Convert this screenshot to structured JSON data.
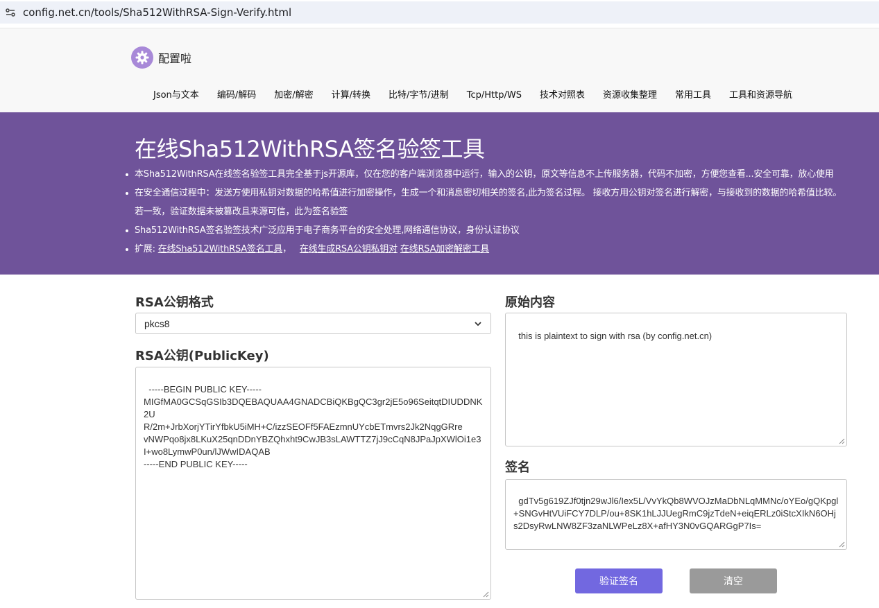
{
  "browser": {
    "url": "config.net.cn/tools/Sha512WithRSA-Sign-Verify.html"
  },
  "header": {
    "logo_text": "配置啦",
    "nav": [
      "Json与文本",
      "编码/解码",
      "加密/解密",
      "计算/转换",
      "比特/字节/进制",
      "Tcp/Http/WS",
      "技术对照表",
      "资源收集整理",
      "常用工具",
      "工具和资源导航"
    ]
  },
  "hero": {
    "title": "在线Sha512WithRSA签名验签工具",
    "bullets": [
      "本Sha512WithRSA在线签名验签工具完全基于js开源库，仅在您的客户端浏览器中运行，输入的公钥，原文等信息不上传服务器，代码不加密，方便您查看...安全可靠，放心使用",
      "在安全通信过程中：发送方使用私钥对数据的哈希值进行加密操作，生成一个和消息密切相关的签名,此为签名过程。 接收方用公钥对签名进行解密，与接收到的数据的哈希值比较。若一致，验证数据未被篡改且来源可信，此为签名验签",
      "Sha512WithRSA签名验签技术广泛应用于电子商务平台的安全处理,网络通信协议，身份认证协议"
    ],
    "ext_prefix": "扩展:",
    "ext_links": [
      "在线Sha512WithRSA签名工具",
      "在线生成RSA公钥私钥对",
      "在线RSA加密解密工具"
    ],
    "ext_sep": "，"
  },
  "form": {
    "format_label": "RSA公钥格式",
    "format_value": "pkcs8",
    "pubkey_label": "RSA公钥(PublicKey)",
    "pubkey_value": "-----BEGIN PUBLIC KEY-----\nMIGfMA0GCSqGSIb3DQEBAQUAA4GNADCBiQKBgQC3gr2jE5o96SeitqtDIUDDNK2U\nR/2m+JrbXorjYTirYfbkU5iMH+C/izzSEOFf5FAEzmnUYcbETmvrs2Jk2NqgGRre\nvNWPqo8jx8LKuX25qnDDnYBZQhxht9CwJB3sLAWTTZ7jJ9cCqN8JPaJpXWlOi1e3\nI+wo8LymwP0un/lJWwIDAQAB\n-----END PUBLIC KEY-----",
    "plaintext_label": "原始内容",
    "plaintext_value": "this is plaintext to sign with rsa (by config.net.cn)",
    "signature_label": "签名",
    "signature_value": "gdTv5g619ZJf0tjn29wJl6/Iex5L/VvYkQb8WVOJzMaDbNLqMMNc/oYEo/gQKpgl+SNGvHtVUiFCY7DLP/ou+8SK1hLJJUegRmC9jzTdeN+eiqERLz0iStcXIkN6OHjs2DsyRwLNW8ZF3zaNLWPeLz8X+afHY3N0vGQARGgP7Is=",
    "verify_button": "验证签名",
    "clear_button": "清空"
  },
  "colors": {
    "hero_bg": "#6f539a",
    "verify_btn": "#7268e0",
    "clear_btn": "#9a9a9a"
  }
}
